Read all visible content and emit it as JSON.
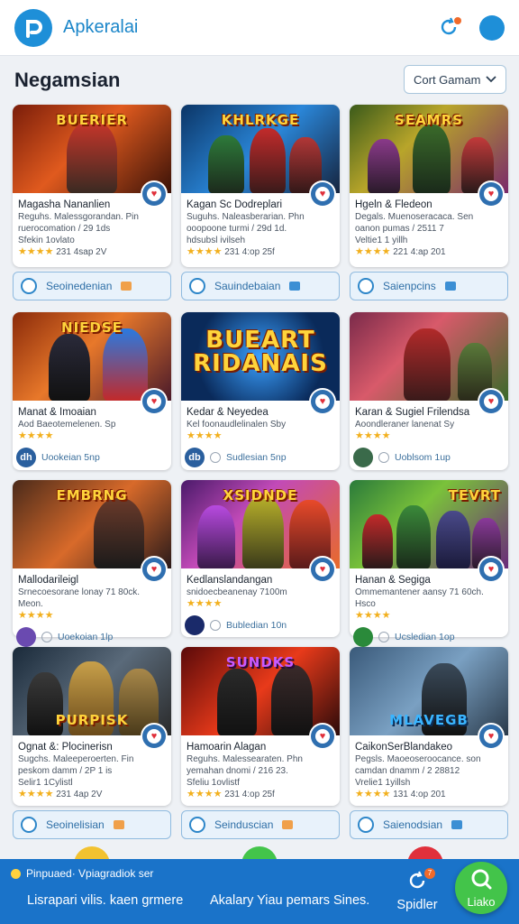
{
  "header": {
    "title": "Apkeralai"
  },
  "section": {
    "title": "Negamsian",
    "sort_label": "Cort Gamam"
  },
  "colors": {
    "accent": "#1e8fd8",
    "bottom_bar": "#1a73c9",
    "fab": "#43c44a",
    "star": "#f2b01e",
    "heart": "#e0303b"
  },
  "cards": [
    {
      "thumb_label": "BUERIER",
      "title": "Magasha Nananlien",
      "sub1": "Reguhs. Malessgorandan. Pin",
      "sub2": "ruerocomation / 29 1ds",
      "sub3": "Sfekin 1ovlato",
      "meta": "231 4sap 2V",
      "footer": ""
    },
    {
      "thumb_label": "KHLRKGE",
      "title": "Kagan Sc Dodreplari",
      "sub1": "Suguhs. Naleasberarian. Phn",
      "sub2": "ooopoone turmi / 29d 1d.",
      "sub3": "hdsubsl ivilseh",
      "meta": "231 4:op 25f",
      "footer": ""
    },
    {
      "thumb_label": "SEAMRS",
      "title": "Hgeln & Fledeon",
      "sub1": "Degals. Muenoseracaca. Sen",
      "sub2": "oanon pumas / 2511 7",
      "sub3": "Veltie1 1 yillh",
      "meta": "221 4:ap 201",
      "footer": ""
    },
    {
      "thumb_label": "NIEDSE",
      "title": "Manat & Imoaian",
      "sub1": "Aod Baeotemelenen. Sp",
      "sub2": "",
      "sub3": "",
      "meta": "",
      "footer": "Uookeian 5np",
      "avatar": "dh"
    },
    {
      "thumb_label": "BUEART RIDANAIS",
      "title": "Kedar & Neyedea",
      "sub1": "Kel foonaudlelinalen Sby",
      "sub2": "",
      "sub3": "",
      "meta": "",
      "footer": "Sudlesian 5np",
      "avatar": "db"
    },
    {
      "thumb_label": "",
      "title": "Karan & Sugiel Frilendsa",
      "sub1": "Aoondleraner lanenat Sy",
      "sub2": "",
      "sub3": "",
      "meta": "",
      "footer": "Uoblsom 1up",
      "avatar": ""
    },
    {
      "thumb_label": "EMBRNG",
      "title": "Mallodarileigl",
      "sub1": "Srnecoesorane lonay 71 80ck. Meon.",
      "sub2": "",
      "sub3": "",
      "meta": "",
      "footer": "Uoekoian 1lp",
      "avatar": ""
    },
    {
      "thumb_label": "XSIDNDE",
      "title": "Kedlanslandangan",
      "sub1": "snidoecbeanenay 7100m",
      "sub2": "",
      "sub3": "",
      "meta": "",
      "footer": "Bubledian 10n",
      "avatar": ""
    },
    {
      "thumb_label": "TEVRT",
      "title": "Hanan & Segiga",
      "sub1": "Ommemantener aansy 71 60ch. Hsco",
      "sub2": "",
      "sub3": "",
      "meta": "",
      "footer": "Ucsledian 1op",
      "avatar": ""
    },
    {
      "thumb_label": "PURPISK",
      "title": "Ognat &: Plocinerisn",
      "sub1": "Sugchs. Maleeperoerten. Fin",
      "sub2": "peskom damm / 2P 1 is",
      "sub3": "Selir1 1Cylistl",
      "meta": "231 4ap 2V",
      "footer": ""
    },
    {
      "thumb_label": "SUNDKS",
      "title": "Hamoarin Alagan",
      "sub1": "Reguhs. Malessearaten. Phn",
      "sub2": "yemahan dnomi / 216 23.",
      "sub3": "Sfeliu 1ovlistf",
      "meta": "231 4:op 25f",
      "footer": ""
    },
    {
      "thumb_label": "MLAVEGB",
      "title": "CaikonSerBlandakeo",
      "sub1": "Pegsls. Maoeoseroocance. son",
      "sub2": "camdan dnamm / 2 28812",
      "sub3": "Vrelie1 1yillsh",
      "meta": "131 4:op 201",
      "footer": ""
    }
  ],
  "store_buttons": [
    {
      "label": "Seoinedenian"
    },
    {
      "label": "Sauindebaian"
    },
    {
      "label": "Saienpcins"
    },
    {
      "label": "Seoinelisian"
    },
    {
      "label": "Seinduscian"
    },
    {
      "label": "Saienodsian"
    }
  ],
  "bottom": {
    "status": "Pinpuaed· Vpiagradiok ser",
    "left_text": "Lisrapari vilis. kaen grmere",
    "mid_text": "Akalary Yiau pemars Sines.",
    "spider_label": "Spidler",
    "spider_badge": "7",
    "fab_label": "Liako"
  }
}
